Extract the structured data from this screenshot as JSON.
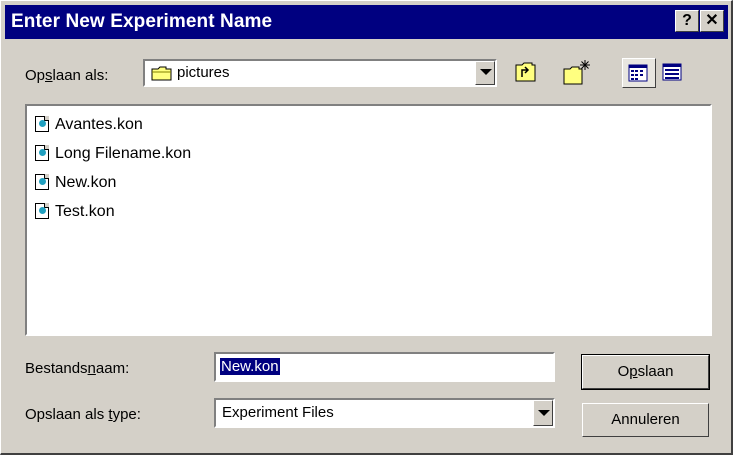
{
  "window": {
    "title": "Enter New Experiment Name",
    "help_label": "?",
    "close_label": "✕"
  },
  "save_in": {
    "label_pre": "Op",
    "label_accel": "s",
    "label_post": "laan als:",
    "value": "pictures"
  },
  "toolbar": {
    "up_folder_icon": "up-folder-icon",
    "new_folder_icon": "new-folder-icon",
    "list_view_icon": "list-view-icon",
    "details_view_icon": "details-view-icon"
  },
  "files": [
    {
      "name": "Avantes.kon"
    },
    {
      "name": "Long Filename.kon"
    },
    {
      "name": "New.kon"
    },
    {
      "name": "Test.kon"
    }
  ],
  "filename": {
    "label_pre": "Bestands",
    "label_accel": "n",
    "label_post": "aam:",
    "value": "New.kon"
  },
  "filetype": {
    "label_pre": "Opslaan als ",
    "label_accel": "t",
    "label_post": "ype:",
    "value": "Experiment Files"
  },
  "buttons": {
    "save_pre": "O",
    "save_accel": "p",
    "save_post": "slaan",
    "cancel": "Annuleren"
  }
}
